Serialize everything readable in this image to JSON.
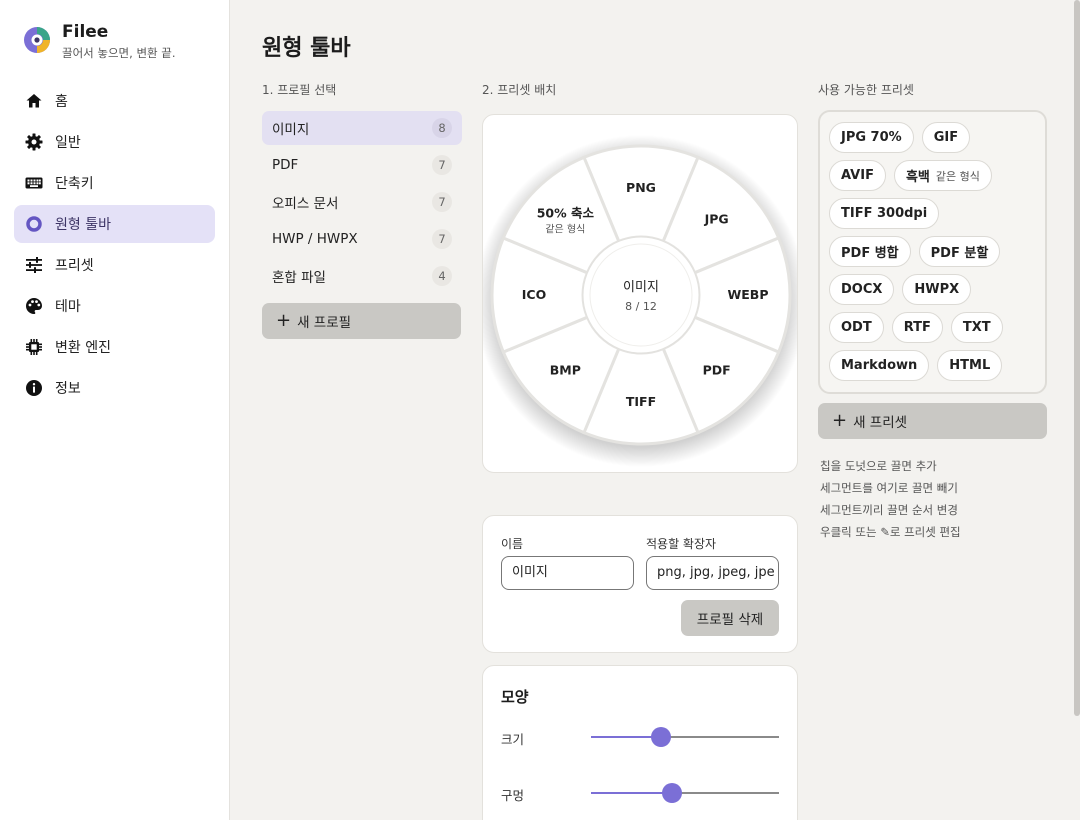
{
  "app": {
    "name": "Filee",
    "tagline": "끌어서 놓으면, 변환 끝.",
    "accent": "#7b6fd6"
  },
  "nav": [
    {
      "label": "홈",
      "icon": "home-icon",
      "active": false
    },
    {
      "label": "일반",
      "icon": "gear-icon",
      "active": false
    },
    {
      "label": "단축키",
      "icon": "keyboard-icon",
      "active": false
    },
    {
      "label": "원형 툴바",
      "icon": "radial-icon",
      "active": true
    },
    {
      "label": "프리셋",
      "icon": "sliders-icon",
      "active": false
    },
    {
      "label": "테마",
      "icon": "palette-icon",
      "active": false
    },
    {
      "label": "변환 엔진",
      "icon": "chip-icon",
      "active": false
    },
    {
      "label": "정보",
      "icon": "info-icon",
      "active": false
    }
  ],
  "page": {
    "title": "원형 툴바"
  },
  "profiles": {
    "label": "1. 프로필 선택",
    "items": [
      {
        "name": "이미지",
        "count": "8",
        "active": true
      },
      {
        "name": "PDF",
        "count": "7",
        "active": false
      },
      {
        "name": "오피스 문서",
        "count": "7",
        "active": false
      },
      {
        "name": "HWP / HWPX",
        "count": "7",
        "active": false
      },
      {
        "name": "혼합 파일",
        "count": "4",
        "active": false
      }
    ],
    "new_label": "새 프로필"
  },
  "wheel": {
    "label": "2. 프리셋 배치",
    "center_title": "이미지",
    "center_sub": "8 / 12",
    "segments": [
      {
        "label": "PNG",
        "sub": ""
      },
      {
        "label": "JPG",
        "sub": ""
      },
      {
        "label": "WEBP",
        "sub": ""
      },
      {
        "label": "PDF",
        "sub": ""
      },
      {
        "label": "TIFF",
        "sub": ""
      },
      {
        "label": "BMP",
        "sub": ""
      },
      {
        "label": "ICO",
        "sub": ""
      },
      {
        "label": "50% 축소",
        "sub": "같은 형식"
      }
    ]
  },
  "form": {
    "name_label": "이름",
    "name_value": "이미지",
    "ext_label": "적용할 확장자",
    "ext_value": "png, jpg, jpeg, jpe",
    "delete_label": "프로필 삭제"
  },
  "shape": {
    "title": "모양",
    "size_label": "크기",
    "size_value": 0.37,
    "hole_label": "구멍",
    "hole_value": 0.43
  },
  "presets": {
    "label": "사용 가능한 프리셋",
    "items": [
      {
        "label": "JPG 70%",
        "sub": ""
      },
      {
        "label": "GIF",
        "sub": ""
      },
      {
        "label": "AVIF",
        "sub": ""
      },
      {
        "label": "흑백",
        "sub": "같은 형식"
      },
      {
        "label": "TIFF 300dpi",
        "sub": ""
      },
      {
        "label": "PDF 병합",
        "sub": ""
      },
      {
        "label": "PDF 분할",
        "sub": ""
      },
      {
        "label": "DOCX",
        "sub": ""
      },
      {
        "label": "HWPX",
        "sub": ""
      },
      {
        "label": "ODT",
        "sub": ""
      },
      {
        "label": "RTF",
        "sub": ""
      },
      {
        "label": "TXT",
        "sub": ""
      },
      {
        "label": "Markdown",
        "sub": ""
      },
      {
        "label": "HTML",
        "sub": ""
      }
    ],
    "new_label": "새 프리셋",
    "help": [
      "칩을 도넛으로 끌면 추가",
      "세그먼트를 여기로 끌면 빼기",
      "세그먼트끼리 끌면 순서 변경",
      "우클릭 또는 ✎로 프리셋 편집"
    ]
  }
}
